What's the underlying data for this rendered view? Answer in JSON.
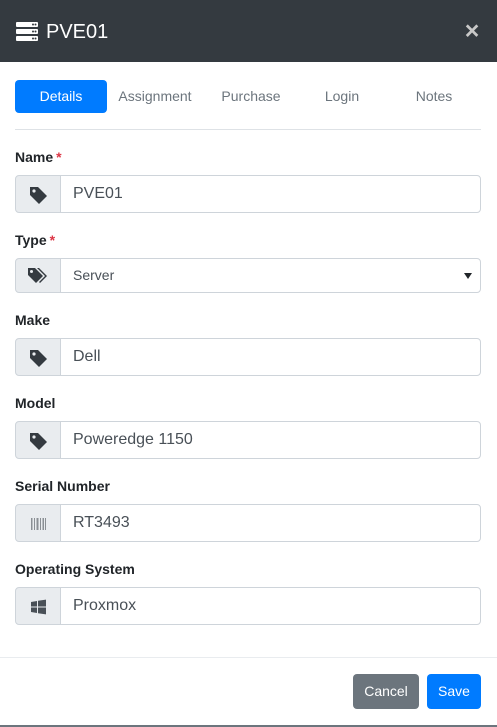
{
  "header": {
    "title": "PVE01",
    "close_glyph": "×",
    "icon": "server-icon"
  },
  "tabs": [
    {
      "label": "Details",
      "active": true
    },
    {
      "label": "Assignment",
      "active": false
    },
    {
      "label": "Purchase",
      "active": false
    },
    {
      "label": "Login",
      "active": false
    },
    {
      "label": "Notes",
      "active": false
    }
  ],
  "form": {
    "required_marker": "*",
    "name": {
      "label": "Name",
      "value": "PVE01",
      "icon": "tag-icon"
    },
    "type": {
      "label": "Type",
      "value": "Server",
      "icon": "tags-icon"
    },
    "make": {
      "label": "Make",
      "value": "Dell",
      "icon": "tag-icon"
    },
    "model": {
      "label": "Model",
      "value": "Poweredge 1150",
      "icon": "tag-icon"
    },
    "serial": {
      "label": "Serial Number",
      "value": "RT3493",
      "icon": "barcode-icon"
    },
    "os": {
      "label": "Operating System",
      "value": "Proxmox",
      "icon": "windows-icon"
    }
  },
  "footer": {
    "cancel_label": "Cancel",
    "save_label": "Save"
  },
  "colors": {
    "header_bg": "#343a40",
    "primary": "#007bff",
    "secondary": "#6c757d",
    "required": "#dc3545",
    "addon_bg": "#e9ecef"
  }
}
